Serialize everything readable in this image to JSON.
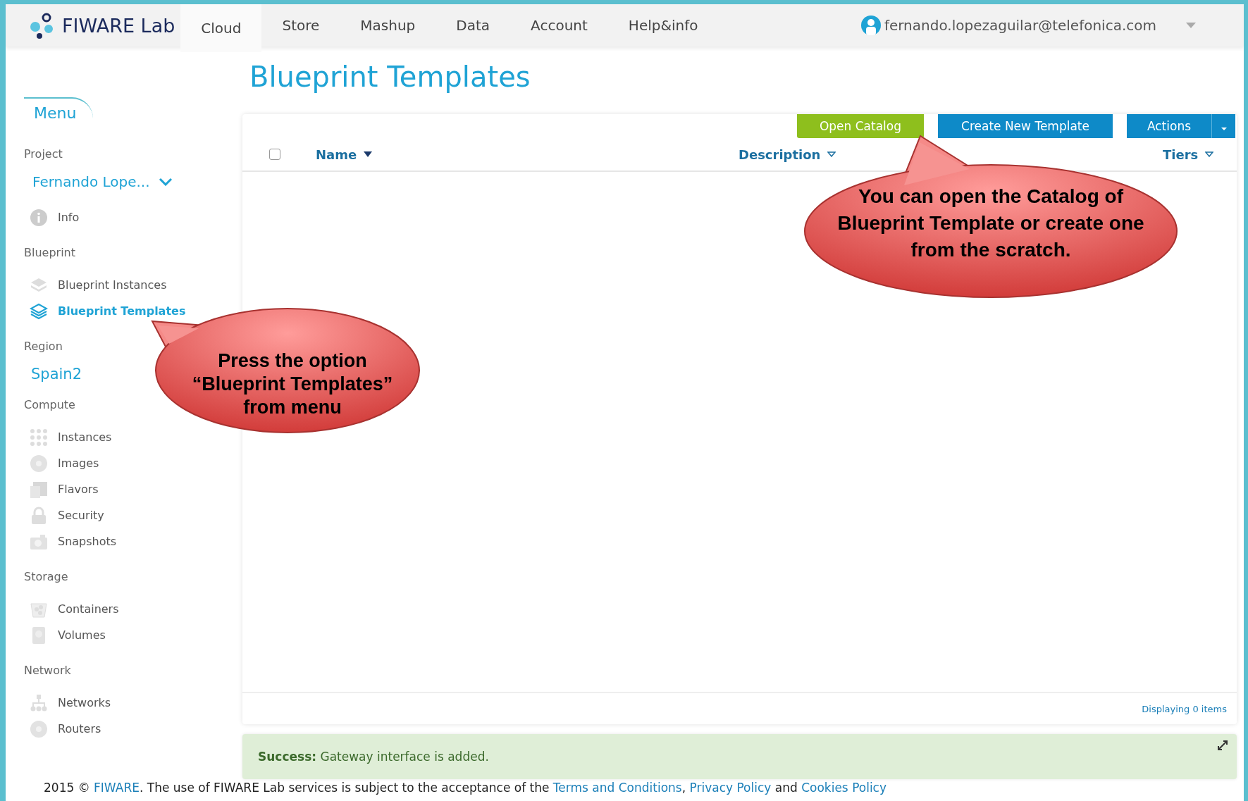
{
  "nav": {
    "logo": "FIWARE Lab",
    "tabs": [
      {
        "label": "Cloud",
        "selected": true
      },
      {
        "label": "Store",
        "selected": false
      },
      {
        "label": "Mashup",
        "selected": false
      },
      {
        "label": "Data",
        "selected": false
      },
      {
        "label": "Account",
        "selected": false
      },
      {
        "label": "Help&info",
        "selected": false
      }
    ],
    "user": "fernando.lopezaguilar@telefonica.com"
  },
  "sidebar": {
    "title": "Menu",
    "sections": [
      {
        "label": "Project",
        "items": [
          {
            "kind": "dropdown",
            "label": "Fernando Lope..."
          },
          {
            "kind": "info",
            "label": "Info",
            "selected": false
          }
        ]
      },
      {
        "label": "Blueprint",
        "items": [
          {
            "kind": "layers",
            "label": "Blueprint Instances",
            "selected": false
          },
          {
            "kind": "layers",
            "label": "Blueprint Templates",
            "selected": true
          }
        ]
      },
      {
        "label": "Region",
        "items": [
          {
            "kind": "region",
            "label": "Spain2"
          }
        ]
      },
      {
        "label": "Compute",
        "items": [
          {
            "kind": "grid",
            "label": "Instances",
            "selected": false
          },
          {
            "kind": "disc",
            "label": "Images",
            "selected": false
          },
          {
            "kind": "square",
            "label": "Flavors",
            "selected": false
          },
          {
            "kind": "lock",
            "label": "Security",
            "selected": false
          },
          {
            "kind": "camera",
            "label": "Snapshots",
            "selected": false
          }
        ]
      },
      {
        "label": "Storage",
        "items": [
          {
            "kind": "bucket",
            "label": "Containers",
            "selected": false
          },
          {
            "kind": "drive",
            "label": "Volumes",
            "selected": false
          }
        ]
      },
      {
        "label": "Network",
        "items": [
          {
            "kind": "tree",
            "label": "Networks",
            "selected": false
          },
          {
            "kind": "disc",
            "label": "Routers",
            "selected": false
          }
        ]
      }
    ]
  },
  "page": {
    "title": "Blueprint Templates",
    "buttons": [
      {
        "kind": "green",
        "label": "Open Catalog"
      },
      {
        "kind": "blue",
        "label": "Create New Template"
      },
      {
        "kind": "split",
        "label": "Actions"
      }
    ],
    "table": {
      "select_all": {
        "checked": false
      },
      "columns": [
        {
          "label": "Name",
          "sorted": true
        },
        {
          "label": "Description",
          "sorted": false
        },
        {
          "label": "Tiers",
          "sorted": false
        }
      ],
      "footer": "Displaying 0 items"
    },
    "message": "**Success:** Gateway interface is added."
  },
  "callouts": [
    {
      "text": "You can open the Catalog of Blueprint Template or create one from the scratch."
    },
    {
      "text": "Press the option “Blueprint Templates” from menu"
    }
  ],
  "footer": [
    {
      "kind": "text",
      "text": "2015 © "
    },
    {
      "kind": "link",
      "text": "FIWARE"
    },
    {
      "kind": "text",
      "text": ". The use of FIWARE Lab services is subject to the acceptance of the "
    },
    {
      "kind": "link",
      "text": "Terms and Conditions"
    },
    {
      "kind": "text",
      "text": ", "
    },
    {
      "kind": "link",
      "text": "Privacy Policy"
    },
    {
      "kind": "text",
      "text": " and "
    },
    {
      "kind": "link",
      "text": "Cookies Policy"
    }
  ]
}
